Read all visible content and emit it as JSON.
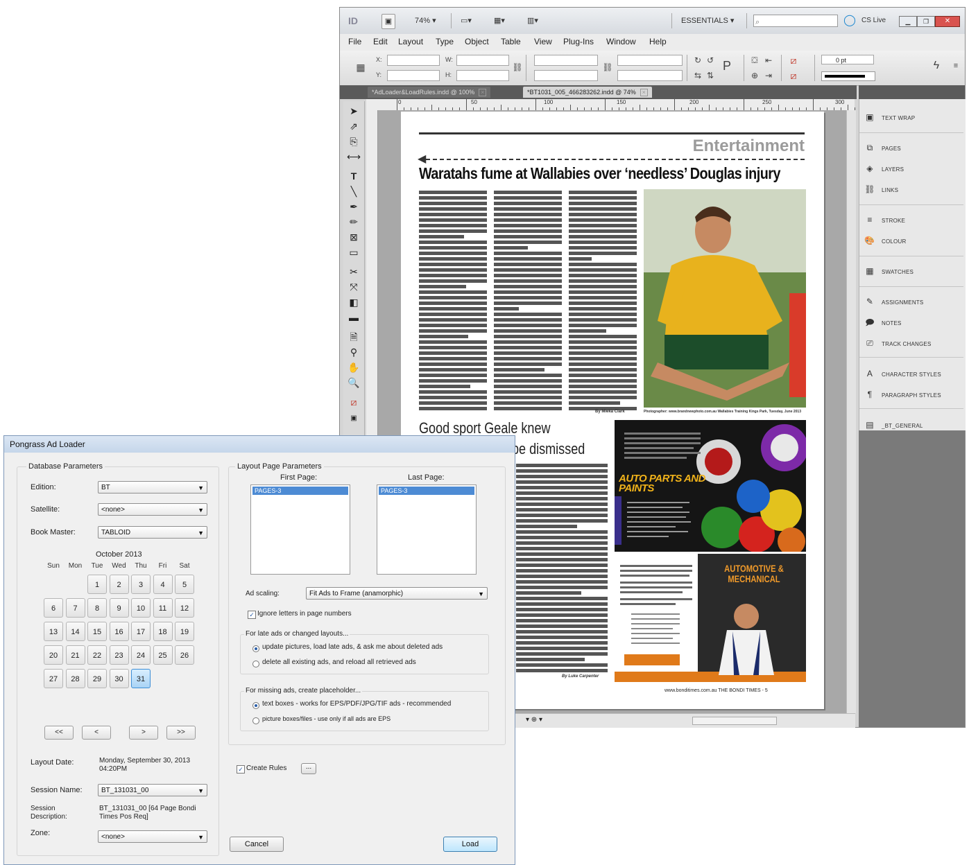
{
  "indesign": {
    "app_logo": "ID",
    "zoom": "74%",
    "workspace": "ESSENTIALS",
    "search_placeholder": "",
    "cs_live": "CS Live",
    "menu": [
      "File",
      "Edit",
      "Layout",
      "Type",
      "Object",
      "Table",
      "View",
      "Plug-Ins",
      "Window",
      "Help"
    ],
    "control": {
      "x_label": "X:",
      "y_label": "Y:",
      "w_label": "W:",
      "h_label": "H:",
      "stroke_weight": "0 pt"
    },
    "tabs": [
      {
        "label": "*AdLoader&LoadRules.indd @ 100%",
        "active": false
      },
      {
        "label": "*BT1031_005_466283262.indd @ 74%",
        "active": true
      }
    ],
    "ruler_numbers": [
      "0",
      "50",
      "100",
      "150",
      "200",
      "250",
      "300"
    ],
    "page": {
      "section": "Entertainment",
      "headline1": "Waratahs fume at Wallabies over ‘needless’ Douglas injury",
      "headline2_line1": "Good sport Geale knew",
      "headline2_line2": "be dismissed",
      "byline1": "By Mieka Clark",
      "photo_caption": "Photographer: www.brandnewphoto.com.au Wallabies Training Kings Park, Tuesday, June 2013",
      "byline2": "By Luke Carpenter",
      "ad1_title": "AUTO PARTS AND PAINTS",
      "ad2_title": "AUTOMOTIVE & MECHANICAL",
      "footer": "www.bonditimes.com.au THE BONDI TIMES - 5"
    },
    "panels": [
      {
        "label": "TEXT WRAP",
        "icon": "text-wrap-icon"
      },
      {
        "label": "PAGES",
        "icon": "pages-icon"
      },
      {
        "label": "LAYERS",
        "icon": "layers-icon"
      },
      {
        "label": "LINKS",
        "icon": "links-icon"
      },
      {
        "label": "STROKE",
        "icon": "stroke-icon"
      },
      {
        "label": "COLOUR",
        "icon": "colour-icon"
      },
      {
        "label": "SWATCHES",
        "icon": "swatches-icon"
      },
      {
        "label": "ASSIGNMENTS",
        "icon": "assignments-icon"
      },
      {
        "label": "NOTES",
        "icon": "notes-icon"
      },
      {
        "label": "TRACK CHANGES",
        "icon": "track-changes-icon"
      },
      {
        "label": "CHARACTER STYLES",
        "icon": "character-styles-icon"
      },
      {
        "label": "PARAGRAPH STYLES",
        "icon": "paragraph-styles-icon"
      },
      {
        "label": "_BT_GENERAL",
        "icon": "library-icon"
      }
    ]
  },
  "dialog": {
    "title": "Pongrass Ad Loader",
    "db_group": "Database Parameters",
    "edition_label": "Edition:",
    "edition_value": "BT",
    "satellite_label": "Satellite:",
    "satellite_value": "<none>",
    "bookmaster_label": "Book Master:",
    "bookmaster_value": "TABLOID",
    "calendar": {
      "month": "October 2013",
      "weekdays": [
        "Sun",
        "Mon",
        "Tue",
        "Wed",
        "Thu",
        "Fri",
        "Sat"
      ],
      "selected_day": "31",
      "nav": [
        "<<",
        "<",
        ">",
        ">>"
      ]
    },
    "layout_date_label": "Layout Date:",
    "layout_date_value": "Monday, September 30, 2013 04:20PM",
    "session_name_label": "Session Name:",
    "session_name_value": "BT_131031_00",
    "session_desc_label": "Session Description:",
    "session_desc_value": "BT_131031_00 [64 Page Bondi Times Pos Req]",
    "zone_label": "Zone:",
    "zone_value": "<none>",
    "layout_group": "Layout Page Parameters",
    "first_page_label": "First Page:",
    "first_page_value": "PAGES-3",
    "last_page_label": "Last Page:",
    "last_page_value": "PAGES-3",
    "ad_scaling_label": "Ad scaling:",
    "ad_scaling_value": "Fit Ads to Frame (anamorphic)",
    "ignore_letters": "Ignore letters in page numbers",
    "late_ads_label": "For late ads or changed layouts...",
    "late_opt1": "update pictures, load late ads, & ask me about deleted ads",
    "late_opt2": "delete all existing ads, and reload all retrieved ads",
    "missing_label": "For missing ads, create placeholder...",
    "missing_opt1": "text boxes - works for EPS/PDF/JPG/TIF ads - recommended",
    "missing_opt2": "picture boxes/files - use only if all ads are EPS",
    "create_rules": "Create Rules",
    "ellipsis": "...",
    "cancel": "Cancel",
    "load": "Load"
  }
}
